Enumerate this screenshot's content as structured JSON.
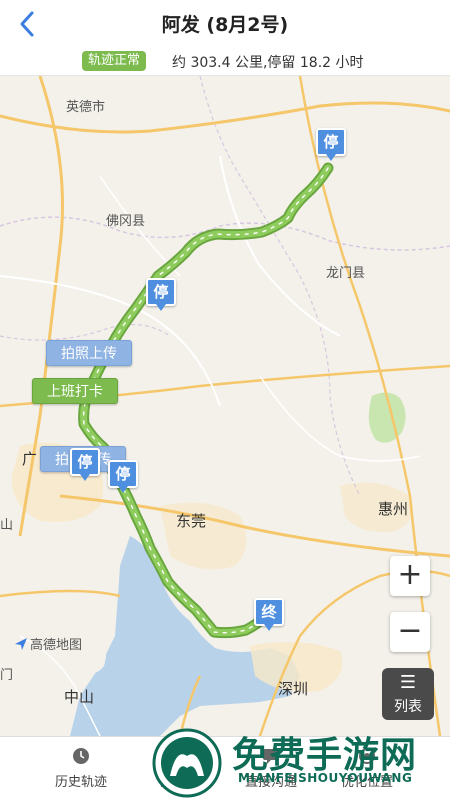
{
  "header": {
    "title": "阿发 (8月2号)",
    "back_icon": "chevron-left-icon"
  },
  "status": {
    "badge": "轨迹正常",
    "summary": "约 303.4 公里,停留 18.2 小时"
  },
  "map": {
    "place_labels": [
      "英德市",
      "佛冈县",
      "龙门县",
      "惠州",
      "东莞",
      "深圳",
      "中山",
      "广",
      "山",
      "门"
    ],
    "stop_marker_label": "停",
    "end_marker_label": "终",
    "callouts": [
      "拍照上传",
      "上班打卡",
      "拍照上传"
    ],
    "brand": "高德地图",
    "route_color": "#7dbb4f",
    "marker_color": "#4f8fe0"
  },
  "controls": {
    "zoom_in": "+",
    "zoom_out": "−",
    "list_label": "列表"
  },
  "bottom_tabs": [
    {
      "label": "历史轨迹",
      "icon": "clock-icon"
    },
    {
      "label": "附近",
      "icon": "location-icon"
    },
    {
      "label": "直接沟通",
      "icon": "chat-icon"
    },
    {
      "label": "优化位置",
      "icon": "pin-icon"
    }
  ],
  "watermark": {
    "text": "免费手游网",
    "sub": "MIANFEISHOUYOUWANG"
  }
}
